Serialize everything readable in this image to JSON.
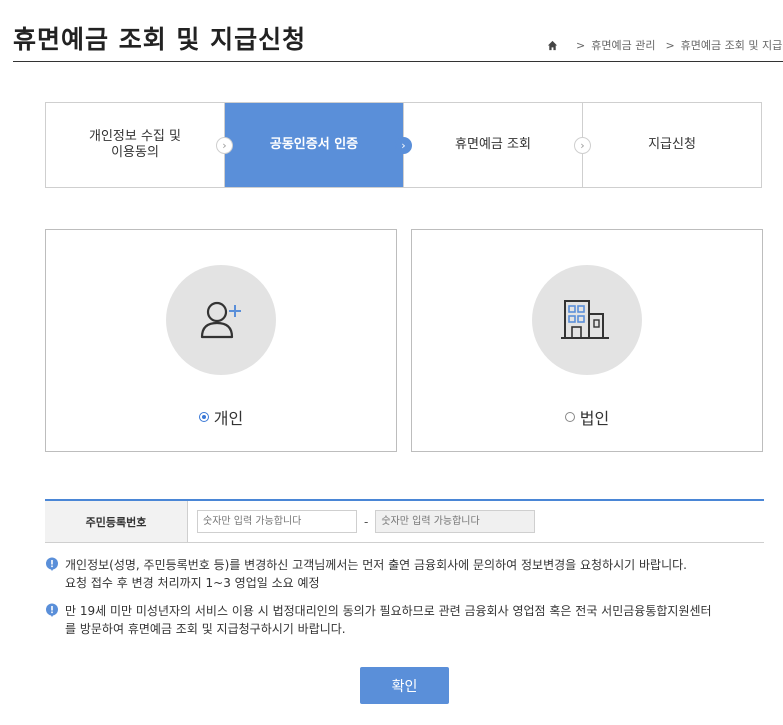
{
  "header": {
    "title": "휴면예금 조회 및 지급신청",
    "breadcrumb": [
      "휴면예금 관리",
      "휴면예금 조회 및 지급신"
    ]
  },
  "steps": [
    {
      "label": "개인정보 수집 및\n이용동의",
      "active": false
    },
    {
      "label": "공동인증서 인증",
      "active": true
    },
    {
      "label": "휴면예금 조회",
      "active": false
    },
    {
      "label": "지급신청",
      "active": false
    }
  ],
  "options": {
    "personal": {
      "label": "개인",
      "icon": "person-add-icon",
      "checked": true
    },
    "corporate": {
      "label": "법인",
      "icon": "building-icon",
      "checked": false
    }
  },
  "form": {
    "label": "주민등록번호",
    "first_placeholder": "숫자만 입력 가능합니다",
    "separator": "-",
    "second_placeholder": "숫자만 입력 가능합니다"
  },
  "notices": [
    {
      "text1": "개인정보(성명, 주민등록번호 등)를 변경하신 고객님께서는 먼저 출연 금융회사에 문의하여 정보변경을 요청하시기 바랍니다.",
      "text2": "요청 접수 후 변경 처리까지 1~3 영업일 소요 예정"
    },
    {
      "text1": "만 19세 미만 미성년자의 서비스 이용 시 법정대리인의 동의가 필요하므로 관련 금융회사 영업점 혹은 전국 서민금융통합지원센터",
      "text2": "를 방문하여 휴면예금 조회 및 지급청구하시기 바랍니다."
    }
  ],
  "confirm_label": "확인",
  "colors": {
    "accent": "#5a8fd9",
    "notice_icon": "#5a8fd9"
  }
}
